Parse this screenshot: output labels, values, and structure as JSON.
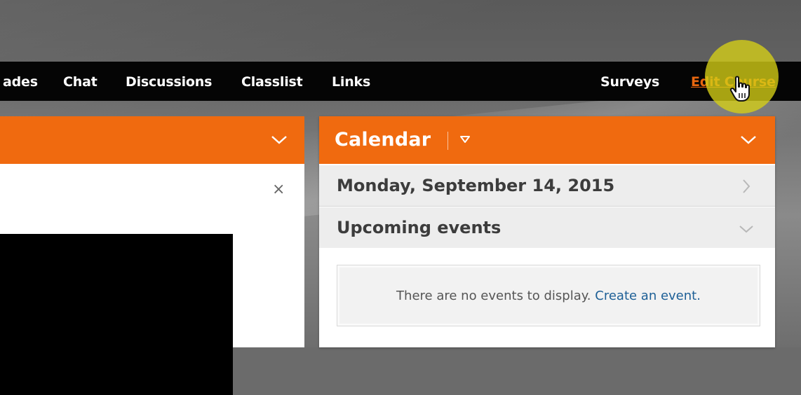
{
  "nav": {
    "items": [
      {
        "label": "ades"
      },
      {
        "label": "Chat"
      },
      {
        "label": "Discussions"
      },
      {
        "label": "Classlist"
      },
      {
        "label": "Links"
      },
      {
        "label": "Surveys"
      },
      {
        "label": "Edit Course"
      }
    ]
  },
  "left_widget": {
    "close_glyph": "×"
  },
  "calendar": {
    "title": "Calendar",
    "date_label": "Monday, September 14, 2015",
    "upcoming_label": "Upcoming events",
    "empty_text": "There are no events to display.",
    "create_link": "Create an event."
  },
  "colors": {
    "accent": "#f06a0f",
    "link": "#1d5f96",
    "navbar": "#050505"
  }
}
